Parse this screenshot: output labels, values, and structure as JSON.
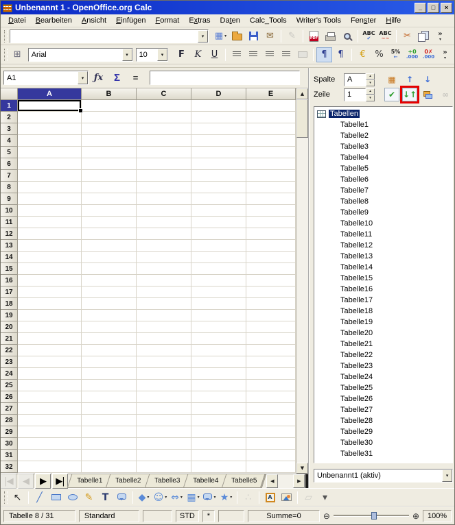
{
  "window": {
    "title": "Unbenannt 1 - OpenOffice.org Calc",
    "minimize": "_",
    "maximize": "□",
    "close": "×"
  },
  "menu": {
    "items": [
      {
        "label": "Datei",
        "accel": 0
      },
      {
        "label": "Bearbeiten",
        "accel": 0
      },
      {
        "label": "Ansicht",
        "accel": 0
      },
      {
        "label": "Einfügen",
        "accel": 0
      },
      {
        "label": "Format",
        "accel": 0
      },
      {
        "label": "Extras",
        "accel": 1
      },
      {
        "label": "Daten",
        "accel": 2
      },
      {
        "label": "Calc_Tools",
        "accel": -1
      },
      {
        "label": "Writer's Tools",
        "accel": -1
      },
      {
        "label": "Fenster",
        "accel": 3
      },
      {
        "label": "Hilfe",
        "accel": 0
      }
    ]
  },
  "standard_toolbar": {
    "url_value": "",
    "buttons": [
      {
        "name": "new-spreadsheet-button",
        "glyph": "▦",
        "color": "#5b7fd4",
        "dropdown": true
      },
      {
        "name": "open-button",
        "shape": "folder"
      },
      {
        "name": "save-button",
        "shape": "floppy"
      },
      {
        "name": "email-document-button",
        "glyph": "✉",
        "color": "#8a6a3a"
      },
      {
        "sep": true
      },
      {
        "name": "edit-file-button",
        "glyph": "✎",
        "color": "#999",
        "disabled": true
      },
      {
        "sep": true
      },
      {
        "name": "pdf-export-button",
        "shape": "pdf",
        "label": "PDF"
      },
      {
        "name": "print-button",
        "shape": "print"
      },
      {
        "name": "page-preview-button",
        "shape": "magnify"
      },
      {
        "sep": true
      },
      {
        "name": "spellcheck-button",
        "shape": "stack",
        "label": "ABC",
        "sub": "✔",
        "subcolor": "#3a6bd6"
      },
      {
        "name": "autospellcheck-button",
        "shape": "stack",
        "label": "ABC",
        "sub": "~~",
        "subcolor": "#d03020"
      },
      {
        "sep": true
      },
      {
        "name": "cut-button",
        "glyph": "✂",
        "color": "#c06020"
      },
      {
        "name": "copy-button",
        "shape": "copy"
      },
      {
        "name": "toolbar-overflow-button",
        "shape": "stack",
        "label": "»",
        "sub": "▾",
        "cls": "ovf"
      }
    ]
  },
  "formatting_toolbar": {
    "font_name": "Arial",
    "font_size": "10",
    "buttons": [
      {
        "name": "bold-button",
        "glyph": "F",
        "style": "bold"
      },
      {
        "name": "italic-button",
        "glyph": "K",
        "style": "italic"
      },
      {
        "name": "underline-button",
        "glyph": "U",
        "style": "underline"
      },
      {
        "sep": true
      },
      {
        "name": "align-left-button",
        "shape": "bars"
      },
      {
        "name": "align-center-button",
        "shape": "bars"
      },
      {
        "name": "align-right-button",
        "shape": "bars"
      },
      {
        "name": "align-justify-button",
        "shape": "bars"
      },
      {
        "name": "merge-cells-button",
        "shape": "rect",
        "disabled": true
      },
      {
        "sep": true
      },
      {
        "name": "left-to-right-button",
        "glyph": "¶",
        "color": "#2a3a8e",
        "active": true
      },
      {
        "name": "right-to-left-button",
        "glyph": "¶",
        "color": "#2a3a8e"
      },
      {
        "sep": true
      },
      {
        "name": "number-format-currency-button",
        "glyph": "€",
        "color": "#d4a017"
      },
      {
        "name": "number-format-percent-button",
        "glyph": "%",
        "color": "#333"
      },
      {
        "name": "number-format-standard-button",
        "shape": "stack",
        "label": "5%",
        "sub": "←",
        "subcolor": "#3a6bd6"
      },
      {
        "name": "add-decimal-button",
        "shape": "stack",
        "label": "+0",
        "labelcolor": "#2e9e2e",
        "sub": ".000",
        "subcolor": "#3a6bd6"
      },
      {
        "name": "delete-decimal-button",
        "shape": "stack",
        "label": "0✗",
        "labelcolor": "#d02020",
        "sub": ".000",
        "subcolor": "#3a6bd6"
      },
      {
        "name": "toolbar-overflow-button",
        "shape": "stack",
        "label": "»",
        "sub": "▾",
        "cls": "ovf"
      }
    ]
  },
  "formula_bar": {
    "cell_reference": "A1",
    "fx_label": "ƒx",
    "sum_label": "Σ",
    "equals_label": "=",
    "formula_value": ""
  },
  "grid": {
    "columns": [
      "A",
      "B",
      "C",
      "D",
      "E"
    ],
    "rows": [
      "1",
      "2",
      "3",
      "4",
      "5",
      "6",
      "7",
      "8",
      "9",
      "10",
      "11",
      "12",
      "13",
      "14",
      "15",
      "16",
      "17",
      "18",
      "19",
      "20",
      "21",
      "22",
      "23",
      "24",
      "25",
      "26",
      "27",
      "28",
      "29",
      "30",
      "31",
      "32"
    ],
    "selected_column": "A",
    "selected_row": "1",
    "scroll_up": "▲",
    "scroll_down": "▼"
  },
  "sheet_tabs": {
    "nav": [
      {
        "name": "first-sheet-button",
        "glyph": "|◀",
        "cls": "tnav",
        "disabled": true
      },
      {
        "name": "previous-sheet-button",
        "glyph": "◀",
        "cls": "tnav",
        "disabled": true
      },
      {
        "name": "next-sheet-button",
        "glyph": "▶",
        "cls": "tnav"
      },
      {
        "name": "last-sheet-button",
        "glyph": "▶|",
        "cls": "tnav"
      }
    ],
    "tabs": [
      "Tabelle1",
      "Tabelle2",
      "Tabelle3",
      "Tabelle4",
      "Tabelle5"
    ],
    "scroll_left": "◀",
    "scroll_right": "▶"
  },
  "navigator": {
    "column_label": "Spalte",
    "column_value": "A",
    "row_label": "Zeile",
    "row_value": "1",
    "spin_up": "▴",
    "spin_down": "▾",
    "icon_row1": [
      {
        "name": "data-range-button",
        "glyph": "▦",
        "color": "#c87820"
      },
      {
        "name": "begin-button",
        "glyph": "↑",
        "color": "#3a6bd6"
      },
      {
        "name": "end-button",
        "glyph": "↓",
        "color": "#3a6bd6"
      }
    ],
    "icon_row2": [
      {
        "name": "contents-button",
        "glyph": "✔",
        "color": "#2e9e2e",
        "cls": "boxed"
      },
      {
        "name": "toggle-button",
        "glyph": "↓↑",
        "color": "#2e9e2e",
        "cls": "boxed",
        "highlight": true
      },
      {
        "name": "scenarios-button",
        "shape": "scen"
      },
      {
        "name": "drag-mode-button",
        "glyph": "∞",
        "color": "#999",
        "disabled": true
      }
    ],
    "tree_root": "Tabellen",
    "tree_root_selected": true,
    "sheets": [
      "Tabelle1",
      "Tabelle2",
      "Tabelle3",
      "Tabelle4",
      "Tabelle5",
      "Tabelle6",
      "Tabelle7",
      "Tabelle8",
      "Tabelle9",
      "Tabelle10",
      "Tabelle11",
      "Tabelle12",
      "Tabelle13",
      "Tabelle14",
      "Tabelle15",
      "Tabelle16",
      "Tabelle17",
      "Tabelle18",
      "Tabelle19",
      "Tabelle20",
      "Tabelle21",
      "Tabelle22",
      "Tabelle23",
      "Tabelle24",
      "Tabelle25",
      "Tabelle26",
      "Tabelle27",
      "Tabelle28",
      "Tabelle29",
      "Tabelle30",
      "Tabelle31"
    ],
    "document_selector": "Unbenannt1 (aktiv)"
  },
  "drawing_toolbar": {
    "buttons": [
      {
        "name": "select-button",
        "glyph": "↖",
        "color": "#222"
      },
      {
        "sep": true
      },
      {
        "name": "line-button",
        "glyph": "╱",
        "color": "#4a78c8"
      },
      {
        "name": "rectangle-button",
        "shape": "rect"
      },
      {
        "name": "ellipse-button",
        "shape": "ellipse"
      },
      {
        "name": "freeform-line-button",
        "glyph": "✎",
        "color": "#d49c20"
      },
      {
        "name": "text-button",
        "glyph": "T",
        "color": "#2a3a6e",
        "style": "bold"
      },
      {
        "name": "callout-button",
        "shape": "bubble"
      },
      {
        "sep": true
      },
      {
        "name": "basic-shapes-button",
        "glyph": "◆",
        "color": "#5b8bd8",
        "dropdown": true
      },
      {
        "name": "symbol-shapes-button",
        "glyph": "☺",
        "color": "#5b8bd8",
        "dropdown": true
      },
      {
        "name": "block-arrows-button",
        "glyph": "⇔",
        "color": "#5b8bd8",
        "dropdown": true
      },
      {
        "name": "flowchart-button",
        "glyph": "▦",
        "color": "#5b8bd8",
        "dropdown": true
      },
      {
        "name": "callouts-button",
        "shape": "bubble",
        "dropdown": true
      },
      {
        "name": "stars-button",
        "glyph": "★",
        "color": "#5b8bd8",
        "dropdown": true
      },
      {
        "sep": true
      },
      {
        "name": "points-button",
        "glyph": "∴",
        "color": "#aaa",
        "disabled": true
      },
      {
        "sep": true
      },
      {
        "name": "fontwork-gallery-button",
        "shape": "fontwork",
        "label": "A"
      },
      {
        "name": "from-file-button",
        "shape": "picture"
      },
      {
        "sep": true
      },
      {
        "name": "extrusion-button",
        "glyph": "▱",
        "color": "#aaa",
        "disabled": true
      },
      {
        "name": "toolbar-overflow-button",
        "glyph": "▾",
        "color": "#555"
      }
    ]
  },
  "status_bar": {
    "sheet_indicator": "Tabelle 8 / 31",
    "page_style": "Standard",
    "selection_mode": "STD",
    "modified_flag": "*",
    "sum": "Summe=0",
    "zoom_out": "⊖",
    "zoom_in": "⊕",
    "zoom_level": "100%"
  }
}
